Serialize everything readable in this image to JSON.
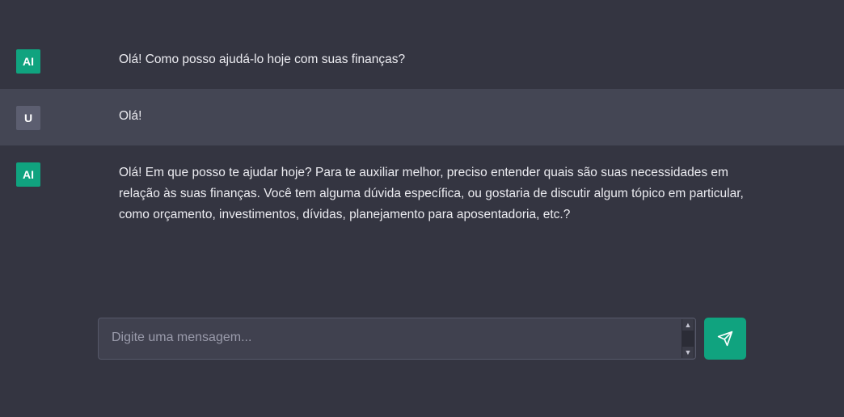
{
  "messages": [
    {
      "role": "ai",
      "avatar": "AI",
      "text": "Olá! Como posso ajudá-lo hoje com suas finanças?"
    },
    {
      "role": "user",
      "avatar": "U",
      "text": "Olá!"
    },
    {
      "role": "ai",
      "avatar": "AI",
      "text": "Olá! Em que posso te ajudar hoje? Para te auxiliar melhor, preciso entender quais são suas necessidades em relação às suas finanças. Você tem alguma dúvida específica, ou gostaria de discutir algum tópico em particular, como orçamento, investimentos, dívidas, planejamento para aposentadoria, etc.?"
    }
  ],
  "composer": {
    "placeholder": "Digite uma mensagem...",
    "value": "",
    "send_icon": "send-icon",
    "scroll_up_icon": "triangle-up-icon",
    "scroll_down_icon": "triangle-down-icon"
  },
  "colors": {
    "background": "#343541",
    "user_row": "#444654",
    "accent": "#10a37f"
  }
}
